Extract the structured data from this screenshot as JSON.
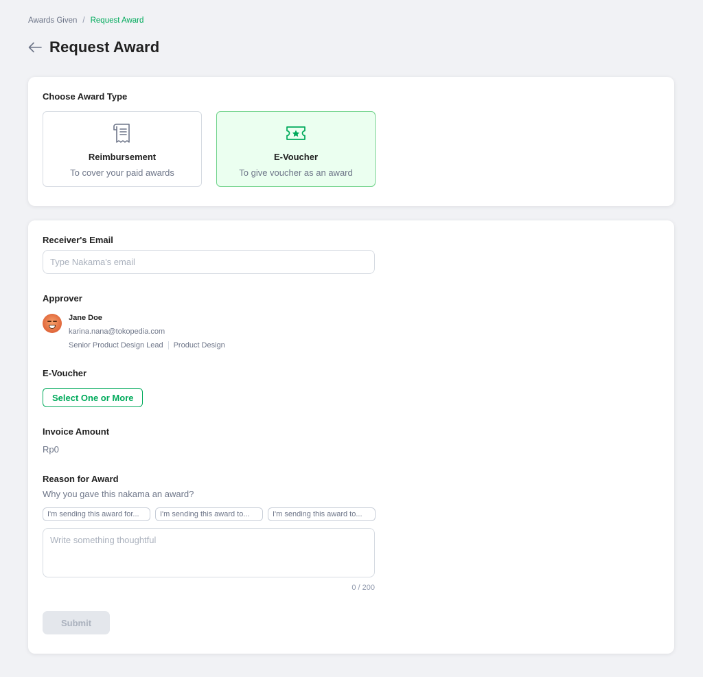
{
  "breadcrumb": {
    "parent": "Awards Given",
    "separator": "/",
    "current": "Request Award"
  },
  "page": {
    "title": "Request Award"
  },
  "award_type": {
    "label": "Choose Award Type",
    "options": [
      {
        "title": "Reimbursement",
        "desc": "To cover your paid awards",
        "icon": "receipt-icon",
        "selected": false
      },
      {
        "title": "E-Voucher",
        "desc": "To give voucher as an award",
        "icon": "ticket-star-icon",
        "selected": true
      }
    ]
  },
  "form": {
    "email_label": "Receiver's Email",
    "email_placeholder": "Type Nakama's email",
    "email_value": "",
    "approver_label": "Approver",
    "approver": {
      "name": "Jane Doe",
      "email": "karina.nana@tokopedia.com",
      "role": "Senior Product Design Lead",
      "department": "Product Design"
    },
    "voucher_label": "E-Voucher",
    "voucher_button": "Select One or More",
    "invoice_label": "Invoice Amount",
    "invoice_value": "Rp0",
    "reason_label": "Reason for Award",
    "reason_subtext": "Why you gave this nakama an award?",
    "chips": [
      "I'm sending this award for...",
      "I'm sending this award to...",
      "I'm sending this award to..."
    ],
    "reason_placeholder": "Write something thoughtful",
    "reason_value": "",
    "counter": "0 / 200",
    "submit_label": "Submit"
  },
  "colors": {
    "accent": "#00aa5b",
    "selected_bg": "#ebfff0",
    "page_bg": "#f1f2f5"
  }
}
